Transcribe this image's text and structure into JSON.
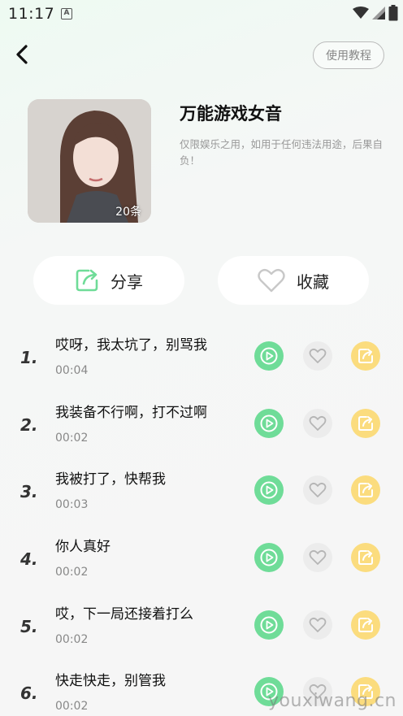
{
  "status_bar": {
    "time": "11:17",
    "indicator": "A"
  },
  "nav": {
    "tutorial_label": "使用教程"
  },
  "album": {
    "title": "万能游戏女音",
    "description": "仅限娱乐之用，如用于任何违法用途，后果自负！",
    "count": "20条"
  },
  "actions": {
    "share_label": "分享",
    "favorite_label": "收藏"
  },
  "items": [
    {
      "num": "1.",
      "title": "哎呀，我太坑了，别骂我",
      "duration": "00:04"
    },
    {
      "num": "2.",
      "title": "我装备不行啊，打不过啊",
      "duration": "00:02"
    },
    {
      "num": "3.",
      "title": "我被打了，快帮我",
      "duration": "00:03"
    },
    {
      "num": "4.",
      "title": "你人真好",
      "duration": "00:02"
    },
    {
      "num": "5.",
      "title": "哎，下一局还接着打么",
      "duration": "00:02"
    },
    {
      "num": "6.",
      "title": "快走快走，别管我",
      "duration": "00:02"
    }
  ],
  "watermark": "youxiwang.cn",
  "colors": {
    "play": "#6fdc98",
    "like": "#ececec",
    "share": "#fbdc7e",
    "share_icon": "#6fdc98"
  }
}
